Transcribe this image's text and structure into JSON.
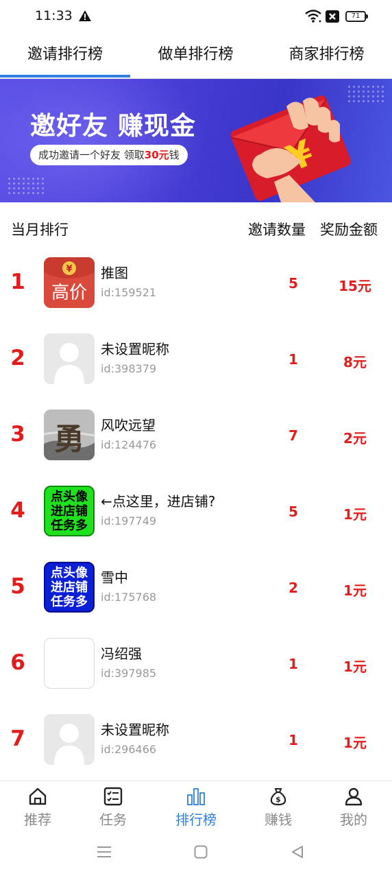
{
  "status_bar": {
    "time": "11:33",
    "battery": "71"
  },
  "tabs": [
    {
      "label": "邀请排行榜",
      "active": true
    },
    {
      "label": "做单排行榜",
      "active": false
    },
    {
      "label": "商家排行榜",
      "active": false
    }
  ],
  "banner": {
    "title": "邀好友 赚现金",
    "subtitle_prefix": "成功邀请一个好友 领取",
    "subtitle_amount": "30元",
    "subtitle_suffix": "钱",
    "envelope_symbol": "¥"
  },
  "ranking": {
    "header_month": "当月排行",
    "header_count": "邀请数量",
    "header_reward": "奖励金额",
    "rows": [
      {
        "rank": "1",
        "name": "推图",
        "id": "id:159521",
        "count": "5",
        "reward": "15元",
        "avatar": "red-envelope-gaojia",
        "avatar_text": "高价"
      },
      {
        "rank": "2",
        "name": "未设置昵称",
        "id": "id:398379",
        "count": "1",
        "reward": "8元",
        "avatar": "default-user"
      },
      {
        "rank": "3",
        "name": "风吹远望",
        "id": "id:124476",
        "count": "7",
        "reward": "2元",
        "avatar": "photo-yong",
        "avatar_text": "勇"
      },
      {
        "rank": "4",
        "name": "←点这里，进店铺?",
        "id": "id:197749",
        "count": "5",
        "reward": "1元",
        "avatar": "green-text",
        "avatar_lines": [
          "点头像",
          "进店铺",
          "任务多"
        ]
      },
      {
        "rank": "5",
        "name": "雪中",
        "id": "id:175768",
        "count": "2",
        "reward": "1元",
        "avatar": "blue-text",
        "avatar_lines": [
          "点头像",
          "进店铺",
          "任务多"
        ]
      },
      {
        "rank": "6",
        "name": "冯绍强",
        "id": "id:397985",
        "count": "1",
        "reward": "1元",
        "avatar": "blank"
      },
      {
        "rank": "7",
        "name": "未设置昵称",
        "id": "id:296466",
        "count": "1",
        "reward": "1元",
        "avatar": "default-user"
      }
    ]
  },
  "bottom_nav": [
    {
      "label": "推荐",
      "icon": "home-icon",
      "active": false
    },
    {
      "label": "任务",
      "icon": "task-list-icon",
      "active": false
    },
    {
      "label": "排行榜",
      "icon": "ranking-bars-icon",
      "active": true
    },
    {
      "label": "赚钱",
      "icon": "money-bag-icon",
      "active": false
    },
    {
      "label": "我的",
      "icon": "user-icon",
      "active": false
    }
  ],
  "colors": {
    "accent_blue": "#2f7fe0",
    "rank_red": "#e21b1b",
    "banner_purple": "#4b3fd8"
  }
}
